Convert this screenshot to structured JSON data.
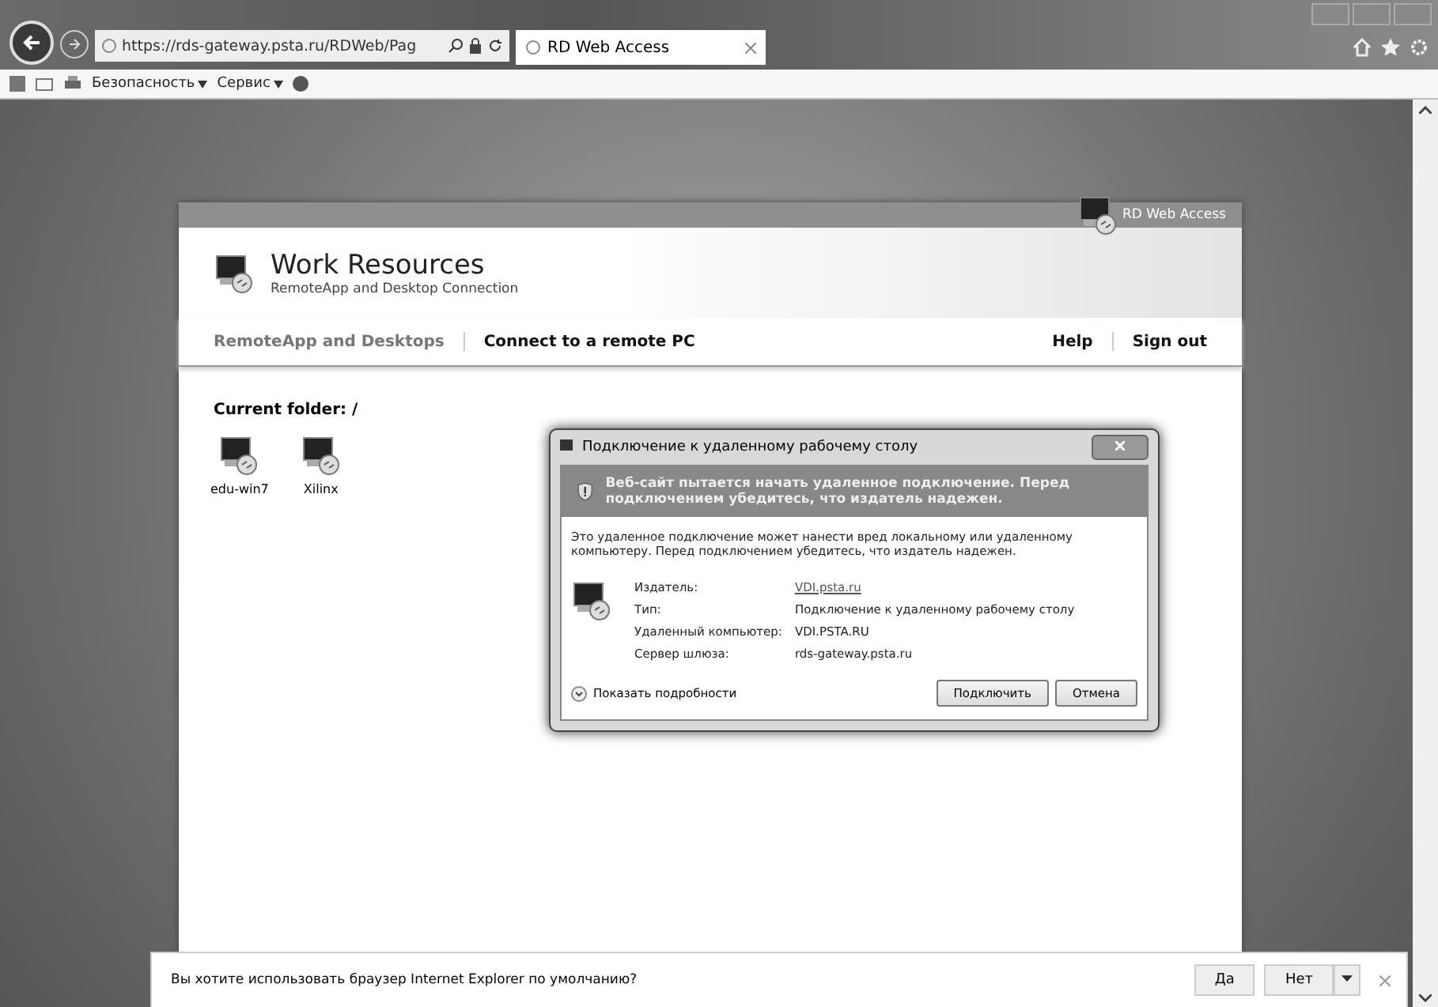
{
  "browser": {
    "address": "https://rds-gateway.psta.ru/RDWeb/Pag",
    "tabs": [
      {
        "label": "RD Web Access",
        "selected": true
      }
    ],
    "command_bar": [
      {
        "label": "Безопасность"
      },
      {
        "label": "Сервис"
      }
    ]
  },
  "page": {
    "top_bar": "RD Web Access",
    "title": "Work Resources",
    "subtitle": "RemoteApp and Desktop Connection",
    "nav": [
      {
        "label": "RemoteApp and Desktops",
        "selected": true
      },
      {
        "label": "Connect to a remote PC",
        "selected": false
      }
    ],
    "links": [
      "Help",
      "Sign out"
    ],
    "folder": "Current folder: /",
    "apps": [
      {
        "name": "edu-win7"
      },
      {
        "name": "Xilinx"
      }
    ]
  },
  "dialog": {
    "title": "Подключение к удаленному рабочему столу",
    "warning": "Веб-сайт пытается начать удаленное подключение. Перед подключением убедитесь, что издатель надежен.",
    "body": "Это удаленное подключение может нанести вред локальному или удаленному компьютеру. Перед подключением убедитесь, что издатель надежен.",
    "fields": [
      {
        "label": "Издатель:",
        "value": "VDI.psta.ru",
        "kind": "link"
      },
      {
        "label": "Тип:",
        "value": "Подключение к удаленному рабочему столу",
        "kind": "text"
      },
      {
        "label": "Удаленный компьютер:",
        "value": "VDI.PSTA.RU",
        "kind": "text"
      },
      {
        "label": "Сервер шлюза:",
        "value": "rds-gateway.psta.ru",
        "kind": "text"
      }
    ],
    "details": "Показать подробности",
    "buttons": [
      "Подключить",
      "Отмена"
    ]
  },
  "notification": {
    "message": "Вы хотите использовать браузер Internet Explorer по умолчанию?",
    "buttons": [
      "Да",
      "Нет"
    ]
  }
}
